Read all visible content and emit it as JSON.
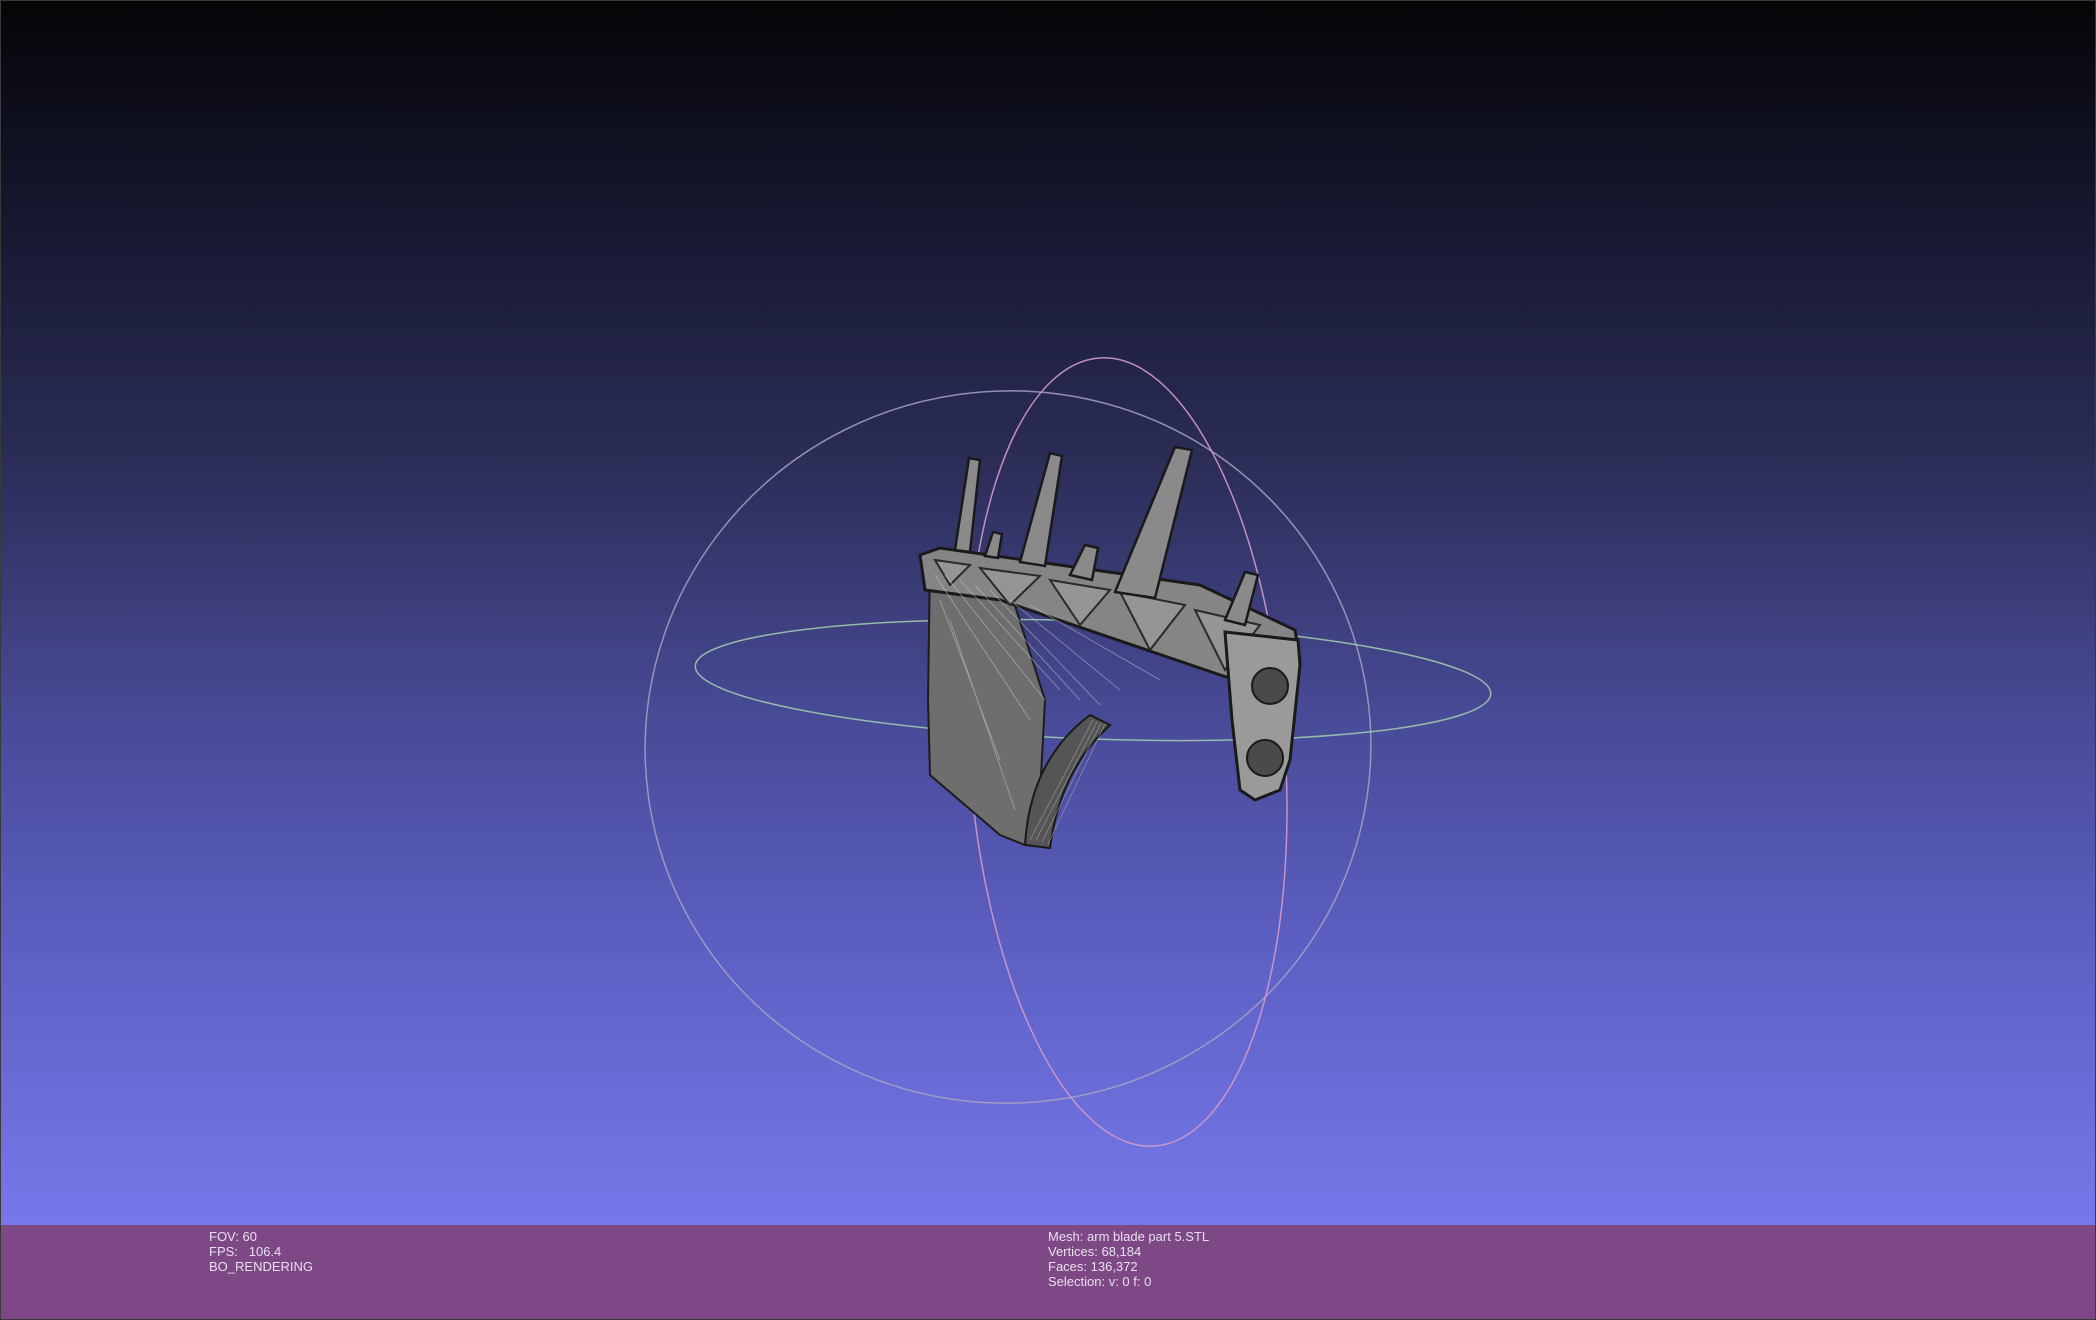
{
  "viewer": {
    "background_top": "#050507",
    "background_bottom": "#7678ea",
    "infobar_color": "#7e4887",
    "trackball": {
      "horizontal_ring_color": "#9fc8b0",
      "vertical_ring_color": "#d49ac8",
      "outer_ring_color": "#a7a2c6"
    },
    "mesh_color": "#7a7a7a"
  },
  "info_left": {
    "fov": "FOV: 60",
    "fps": "FPS:   106.4",
    "render_mode": "BO_RENDERING"
  },
  "info_right": {
    "mesh": "Mesh: arm blade part 5.STL",
    "vertices": "Vertices: 68,184",
    "faces": "Faces: 136,372",
    "selection": "Selection: v: 0 f: 0"
  }
}
